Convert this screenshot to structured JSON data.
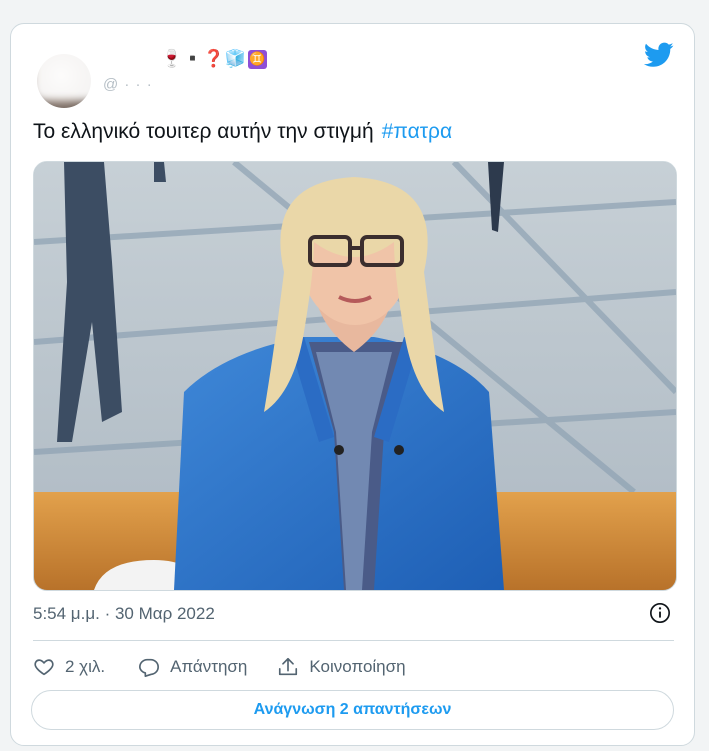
{
  "author": {
    "emoji": "🍷▪️❓🧊",
    "zodiac": "♊",
    "handle": "@ · · ·",
    "avatar_icon": "user-avatar"
  },
  "tweet": {
    "text": "Το ελληνικό τουιτερ αυτήν την στιγμή",
    "hashtag": "#πατρα",
    "timestamp": "5:54 μ.μ. · 30 Μαρ 2022"
  },
  "stats": {
    "likes": "2 χιλ.",
    "reply_label": "Απάντηση",
    "share_label": "Κοινοποίηση"
  },
  "footer": {
    "read_replies": "Ανάγνωση 2 απαντήσεων"
  },
  "colors": {
    "accent": "#1d9bf0",
    "secondary_text": "#536471",
    "border": "#cfd9de"
  }
}
